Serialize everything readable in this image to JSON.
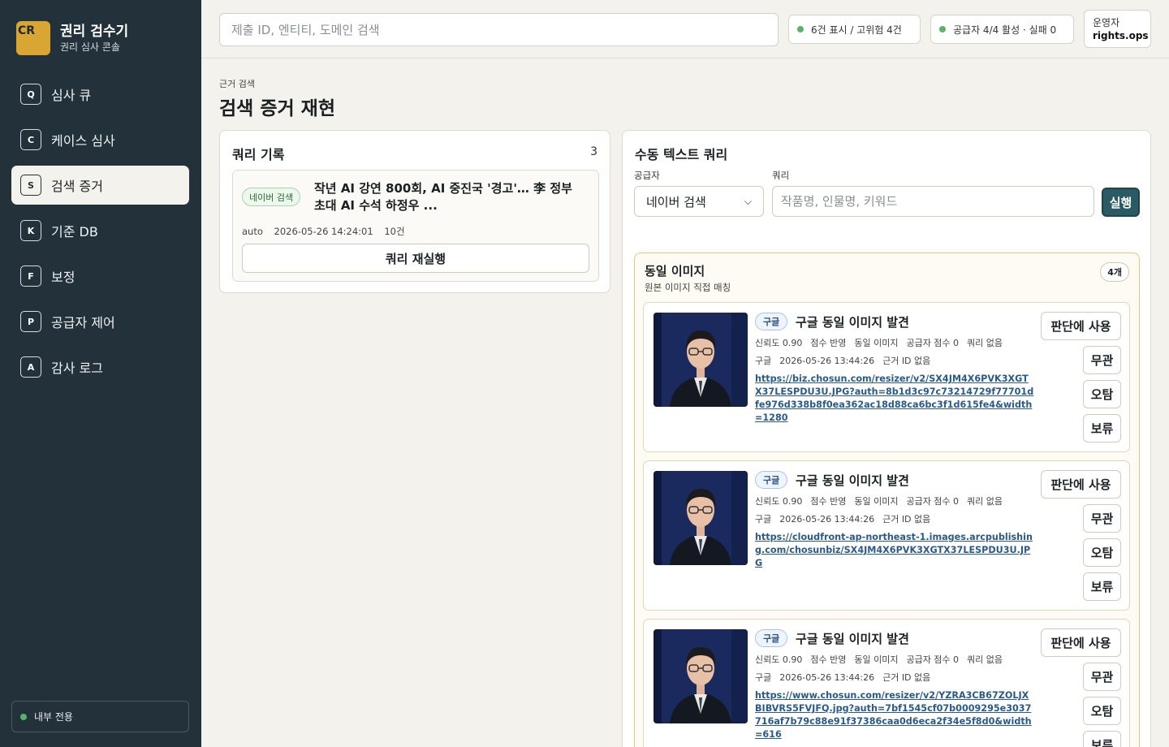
{
  "brand": {
    "logo": "CR",
    "title": "권리 검수기",
    "subtitle": "권리 심사 콘솔"
  },
  "nav": [
    {
      "key": "Q",
      "label": "심사 큐"
    },
    {
      "key": "C",
      "label": "케이스 심사"
    },
    {
      "key": "S",
      "label": "검색 증거",
      "active": true
    },
    {
      "key": "K",
      "label": "기준 DB"
    },
    {
      "key": "F",
      "label": "보정"
    },
    {
      "key": "P",
      "label": "공급자 제어"
    },
    {
      "key": "A",
      "label": "감사 로그"
    }
  ],
  "sidebar_footer": "내부 전용",
  "topbar": {
    "search_placeholder": "제출 ID, 엔티티, 도메인 검색",
    "status_count": "6건 표시 / 고위험 4건",
    "status_provider": "공급자 4/4 활성 · 실패 0",
    "operator_label": "운영자",
    "operator_name": "rights.ops"
  },
  "header": {
    "breadcrumb": "근거 검색",
    "title": "검색 증거 재현"
  },
  "query_log": {
    "title": "쿼리 기록",
    "count": "3",
    "item": {
      "provider_tag": "네이버 검색",
      "text": "작년 AI 강연 800회, AI 중진국 '경고'… 李 정부 초대 AI 수석 하정우 ...",
      "mode": "auto",
      "time": "2026-05-26 14:24:01",
      "results": "10건",
      "rerun_label": "쿼리 재실행"
    }
  },
  "manual_query": {
    "title": "수동 텍스트 쿼리",
    "provider_label": "공급자",
    "provider_value": "네이버 검색",
    "query_label": "쿼리",
    "query_placeholder": "작품명, 인물명, 키워드",
    "run_label": "실행"
  },
  "group": {
    "title": "동일 이미지",
    "subtitle": "원본 이미지 직접 매칭",
    "count": "4개",
    "items": [
      {
        "tag": "구글",
        "title": "구글 동일 이미지 발견",
        "meta1": [
          "신뢰도 0.90",
          "점수 반영",
          "동일 이미지",
          "공급자 점수 0",
          "쿼리 없음"
        ],
        "meta2": [
          "구글",
          "2026-05-26 13:44:26",
          "근거 ID 없음"
        ],
        "url": "https://biz.chosun.com/resizer/v2/SX4JM4X6PVK3XGTX37LESPDU3U.JPG?auth=8b1d3c97c73214729f77701dfe976d338b8f0ea362ac18d88ca6bc3f1d615fe4&width=1280"
      },
      {
        "tag": "구글",
        "title": "구글 동일 이미지 발견",
        "meta1": [
          "신뢰도 0.90",
          "점수 반영",
          "동일 이미지",
          "공급자 점수 0",
          "쿼리 없음"
        ],
        "meta2": [
          "구글",
          "2026-05-26 13:44:26",
          "근거 ID 없음"
        ],
        "url": "https://cloudfront-ap-northeast-1.images.arcpublishing.com/chosunbiz/SX4JM4X6PVK3XGTX37LESPDU3U.JPG"
      },
      {
        "tag": "구글",
        "title": "구글 동일 이미지 발견",
        "meta1": [
          "신뢰도 0.90",
          "점수 반영",
          "동일 이미지",
          "공급자 점수 0",
          "쿼리 없음"
        ],
        "meta2": [
          "구글",
          "2026-05-26 13:44:26",
          "근거 ID 없음"
        ],
        "url": "https://www.chosun.com/resizer/v2/YZRA3CB67ZOLJXBIBVRS5FVJFQ.jpg?auth=7bf1545cf07b0009295e3037716af7b79c88e91f37386caa0d6eca2f34e5f8d0&width=616"
      }
    ]
  },
  "actions": {
    "use": "판단에 사용",
    "irrelevant": "무관",
    "error": "오탐",
    "hold": "보류"
  },
  "colors": {
    "sidebar": "#22313a",
    "accent": "#2a5a63",
    "logo": "#d9a634",
    "status_ok": "#58b368"
  }
}
